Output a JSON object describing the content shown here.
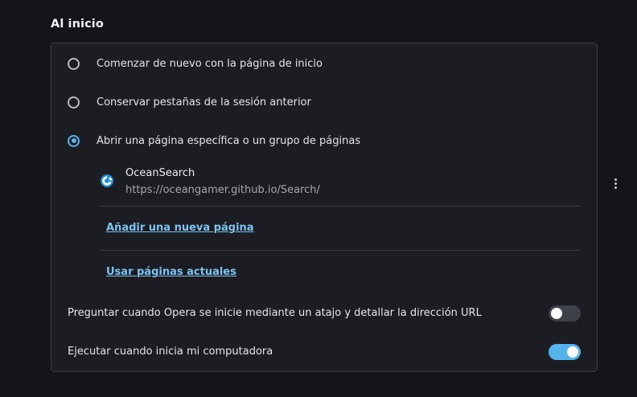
{
  "section": {
    "title": "Al inicio"
  },
  "startup_options": [
    {
      "label": "Comenzar de nuevo con la página de inicio",
      "selected": false
    },
    {
      "label": "Conservar pestañas de la sesión anterior",
      "selected": false
    },
    {
      "label": "Abrir una página específica o un grupo de páginas",
      "selected": true
    }
  ],
  "pages": [
    {
      "name": "OceanSearch",
      "url": "https://oceangamer.github.io/Search/",
      "icon": "oceansearch-logo-icon"
    }
  ],
  "links": {
    "add_page": "Añadir una nueva página",
    "use_current": "Usar páginas actuales"
  },
  "toggles": [
    {
      "label": "Preguntar cuando Opera se inicie mediante un atajo y detallar la dirección URL",
      "on": false
    },
    {
      "label": "Ejecutar cuando inicia mi computadora",
      "on": true
    }
  ],
  "colors": {
    "accent": "#56b2ea",
    "link": "#7cc4f0",
    "card_bg": "#1b1d22",
    "page_bg": "#141519"
  }
}
